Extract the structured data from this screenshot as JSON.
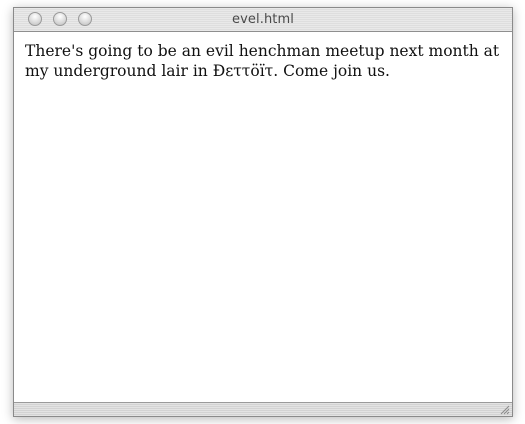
{
  "window": {
    "title": "evel.html"
  },
  "page": {
    "body_text": "There's going to be an evil henchman meetup next month at my underground lair in Ðεττöïτ. Come join us."
  },
  "icons": {
    "close": "close-button-icon",
    "minimize": "minimize-button-icon",
    "zoom": "zoom-button-icon",
    "resize": "resize-grip-icon"
  },
  "colors": {
    "titlebar": "#e4e4e4",
    "title_text": "#4a4a4a",
    "content_bg": "#ffffff",
    "text": "#111111"
  }
}
